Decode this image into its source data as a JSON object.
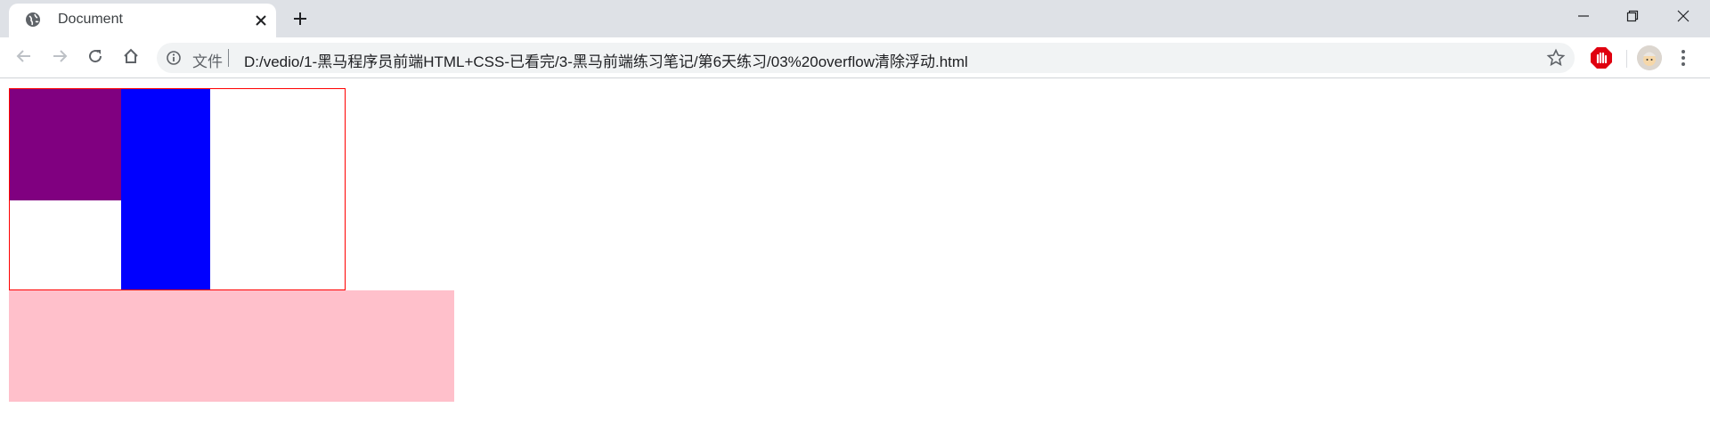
{
  "tab": {
    "title": "Document",
    "favicon": "globe-icon",
    "close_icon": "close-icon"
  },
  "window": {
    "new_tab_icon": "plus-icon",
    "minimize_icon": "minimize-icon",
    "restore_icon": "restore-icon",
    "close_icon": "close-icon"
  },
  "toolbar": {
    "back_icon": "arrow-left-icon",
    "forward_icon": "arrow-right-icon",
    "reload_icon": "reload-icon",
    "home_icon": "home-icon",
    "site_label": "文件",
    "url": "D:/vedio/1-黑马程序员前端HTML+CSS-已看完/3-黑马前端练习笔记/第6天练习/03%20overflow清除浮动.html",
    "bookmark_icon": "star-icon",
    "extension_icon": "adblock-icon",
    "menu_icon": "kebab-menu-icon"
  },
  "colors": {
    "tabstrip_bg": "#dee1e6",
    "container_border": "#ff0000",
    "purple_box": "#800080",
    "blue_box": "#0000ff",
    "pink_box": "#ffc0cb"
  }
}
